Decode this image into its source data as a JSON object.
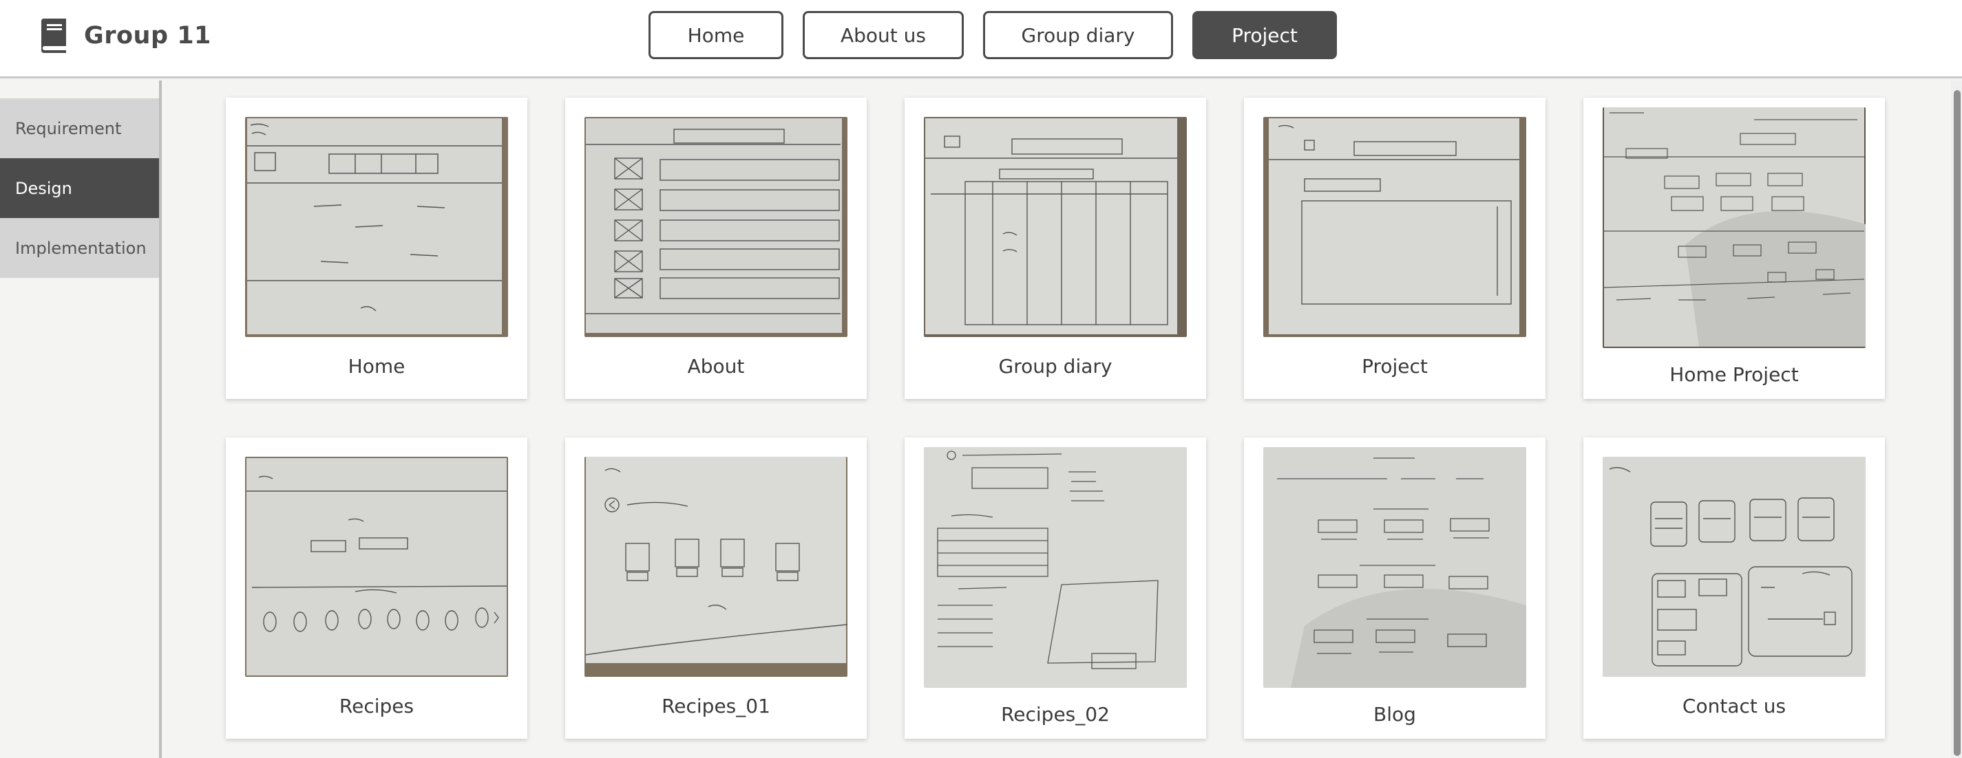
{
  "header": {
    "title": "Group 11",
    "nav": [
      {
        "label": "Home"
      },
      {
        "label": "About us"
      },
      {
        "label": "Group diary"
      },
      {
        "label": "Project"
      }
    ],
    "active_nav": "Project"
  },
  "sidebar": {
    "items": [
      {
        "label": "Requirement"
      },
      {
        "label": "Design"
      },
      {
        "label": "Implementation"
      }
    ],
    "active": "Design"
  },
  "gallery": {
    "cards": [
      {
        "label": "Home"
      },
      {
        "label": "About"
      },
      {
        "label": "Group diary"
      },
      {
        "label": "Project"
      },
      {
        "label": "Home Project"
      },
      {
        "label": "Recipes"
      },
      {
        "label": "Recipes_01"
      },
      {
        "label": "Recipes_02"
      },
      {
        "label": "Blog"
      },
      {
        "label": "Contact us"
      }
    ]
  },
  "colors": {
    "active_fill": "#4b4b4b",
    "header_bg": "#ffffff",
    "page_bg": "#f4f4f2",
    "sidebar_item_bg": "#d4d4d4"
  }
}
